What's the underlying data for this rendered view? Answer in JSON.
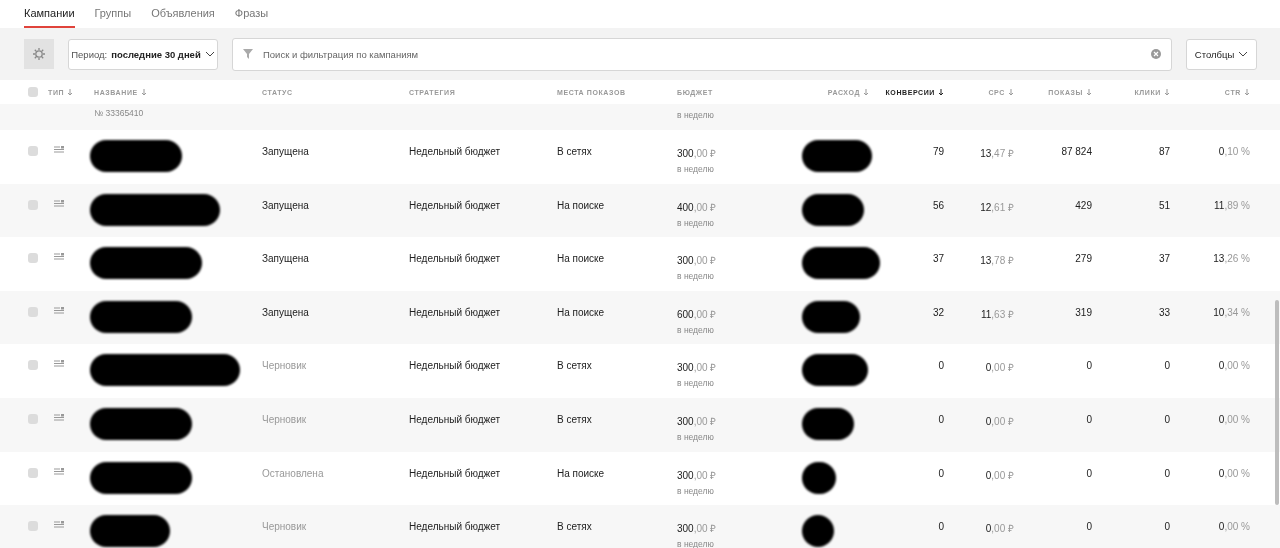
{
  "tabs": [
    {
      "label": "Кампании",
      "selected": true
    },
    {
      "label": "Группы",
      "selected": false
    },
    {
      "label": "Объявления",
      "selected": false
    },
    {
      "label": "Фразы",
      "selected": false
    }
  ],
  "toolbar": {
    "period_label": "Период:",
    "period_value": "последние 30 дней",
    "search": {
      "placeholder": "Поиск и фильтрация по кампаниям"
    },
    "columns_button": "Столбцы"
  },
  "table": {
    "select_all_checked": false,
    "columns": [
      {
        "label": "ТИП",
        "sortable": true,
        "selected": false
      },
      {
        "label": "НАЗВАНИЕ",
        "sortable": true,
        "selected": false
      },
      {
        "label": "СТАТУС",
        "sortable": false,
        "selected": false
      },
      {
        "label": "СТРАТЕГИЯ",
        "sortable": false,
        "selected": false
      },
      {
        "label": "МЕСТА ПОКАЗОВ",
        "sortable": false,
        "selected": false
      },
      {
        "label": "БЮДЖЕТ",
        "sortable": false,
        "selected": false
      },
      {
        "label": "РАСХОД",
        "sortable": true,
        "selected": false
      },
      {
        "label": "КОНВЕРСИИ",
        "sortable": true,
        "selected": true
      },
      {
        "label": "CPC",
        "sortable": true,
        "selected": false
      },
      {
        "label": "ПОКАЗЫ",
        "sortable": true,
        "selected": false
      },
      {
        "label": "КЛИКИ",
        "sortable": true,
        "selected": false
      },
      {
        "label": "CTR",
        "sortable": true,
        "selected": false
      }
    ],
    "partial_row": {
      "number": "№ 33365410",
      "budget_period": "в неделю"
    },
    "rows": [
      {
        "checked": false,
        "status": "Запущена",
        "active": true,
        "strategy": "Недельный бюджет",
        "places": "В сетях",
        "budget": "300,00 ₽",
        "budget_period": "в неделю",
        "conversions": "79",
        "cpc": "13,47 ₽",
        "shows": "87 824",
        "clicks": "87",
        "ctr": "0,10 %"
      },
      {
        "checked": false,
        "status": "Запущена",
        "active": true,
        "strategy": "Недельный бюджет",
        "places": "На поиске",
        "budget": "400,00 ₽",
        "budget_period": "в неделю",
        "conversions": "56",
        "cpc": "12,61 ₽",
        "shows": "429",
        "clicks": "51",
        "ctr": "11,89 %"
      },
      {
        "checked": false,
        "status": "Запущена",
        "active": true,
        "strategy": "Недельный бюджет",
        "places": "На поиске",
        "budget": "300,00 ₽",
        "budget_period": "в неделю",
        "conversions": "37",
        "cpc": "13,78 ₽",
        "shows": "279",
        "clicks": "37",
        "ctr": "13,26 %"
      },
      {
        "checked": false,
        "status": "Запущена",
        "active": true,
        "strategy": "Недельный бюджет",
        "places": "На поиске",
        "budget": "600,00 ₽",
        "budget_period": "в неделю",
        "conversions": "32",
        "cpc": "11,63 ₽",
        "shows": "319",
        "clicks": "33",
        "ctr": "10,34 %"
      },
      {
        "checked": false,
        "status": "Черновик",
        "active": false,
        "strategy": "Недельный бюджет",
        "places": "В сетях",
        "budget": "300,00 ₽",
        "budget_period": "в неделю",
        "conversions": "0",
        "cpc": "0,00 ₽",
        "shows": "0",
        "clicks": "0",
        "ctr": "0,00 %"
      },
      {
        "checked": false,
        "status": "Черновик",
        "active": false,
        "strategy": "Недельный бюджет",
        "places": "В сетях",
        "budget": "300,00 ₽",
        "budget_period": "в неделю",
        "conversions": "0",
        "cpc": "0,00 ₽",
        "shows": "0",
        "clicks": "0",
        "ctr": "0,00 %"
      },
      {
        "checked": false,
        "status": "Остановлена",
        "active": false,
        "strategy": "Недельный бюджет",
        "places": "На поиске",
        "budget": "300,00 ₽",
        "budget_period": "в неделю",
        "conversions": "0",
        "cpc": "0,00 ₽",
        "shows": "0",
        "clicks": "0",
        "ctr": "0,00 %"
      },
      {
        "checked": false,
        "status": "Черновик",
        "active": false,
        "strategy": "Недельный бюджет",
        "places": "В сетях",
        "budget": "300,00 ₽",
        "budget_period": "в неделю",
        "conversions": "0",
        "cpc": "0,00 ₽",
        "shows": "0",
        "clicks": "0",
        "ctr": "0,00 %"
      }
    ]
  }
}
